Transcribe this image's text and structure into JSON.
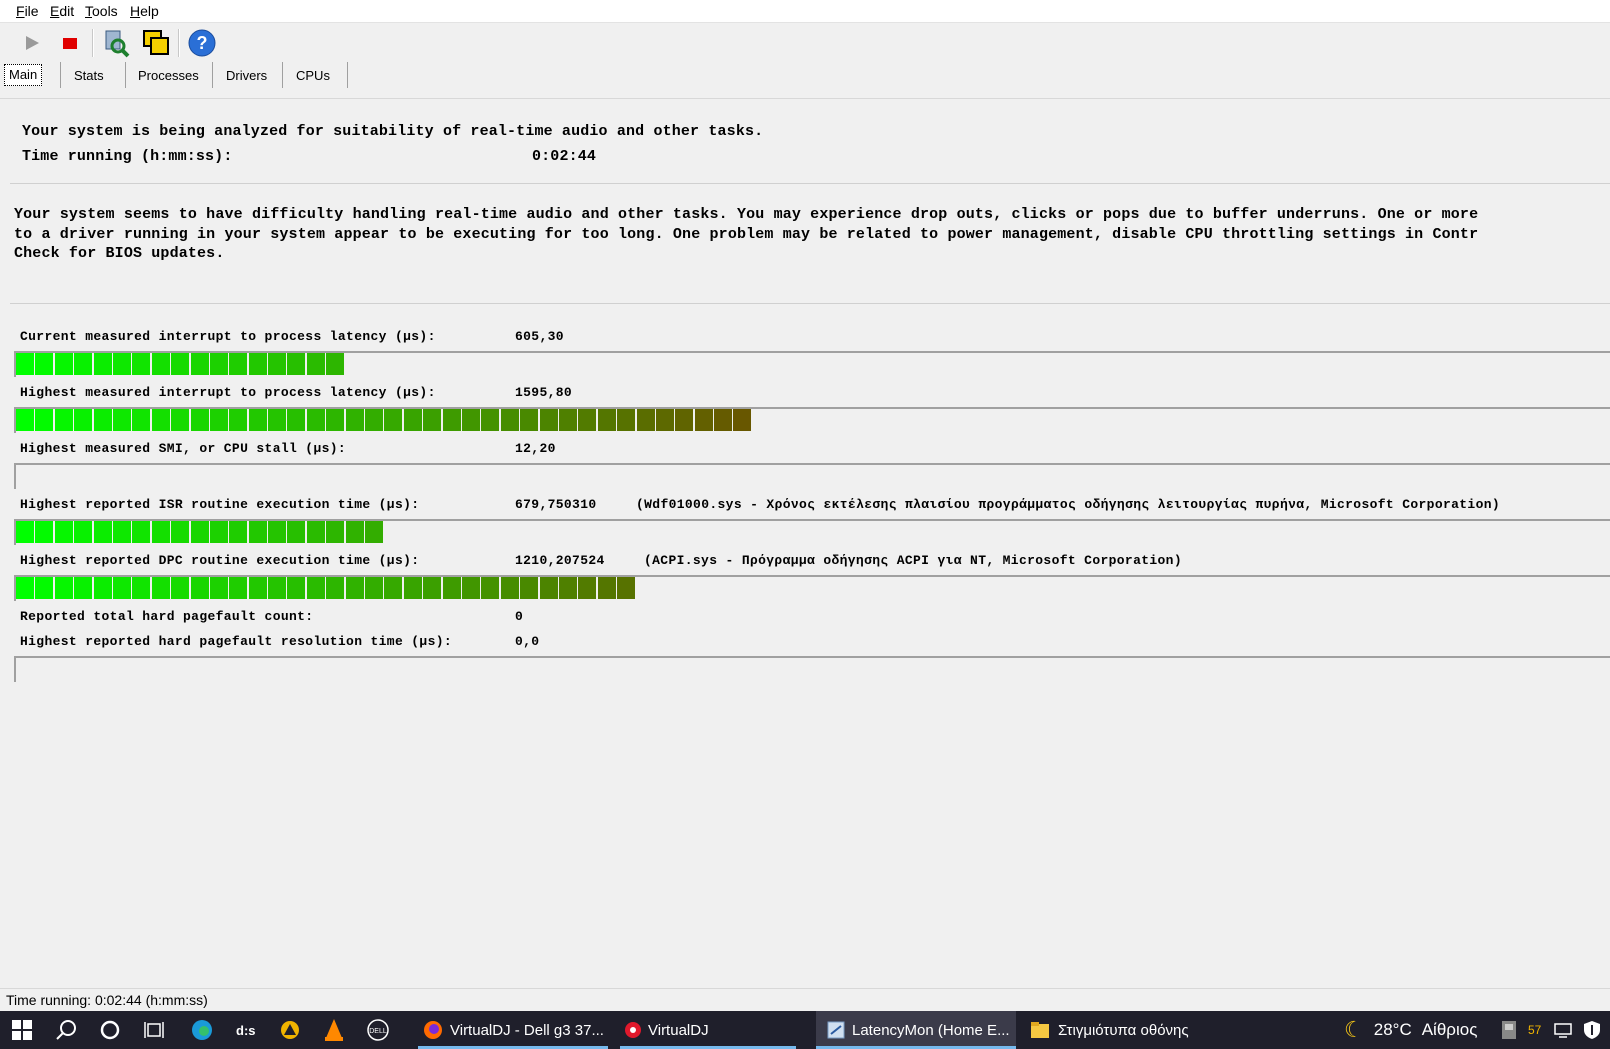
{
  "menu": {
    "items": [
      "File",
      "Edit",
      "Tools",
      "Help"
    ]
  },
  "tabs": [
    "Main",
    "Stats",
    "Processes",
    "Drivers",
    "CPUs"
  ],
  "intro": {
    "line1": "Your system is being analyzed for suitability of real-time audio and other tasks.",
    "time_label": "Time running (h:mm:ss):",
    "time_value": "0:02:44"
  },
  "warning": {
    "text": "Your system seems to have difficulty handling real-time audio and other tasks. You may experience drop outs, clicks or pops due to buffer underruns. One or more\nto a driver running in your system appear to be executing for too long. One problem may be related to power management, disable CPU throttling settings in Contr\nCheck for BIOS updates."
  },
  "metrics": {
    "current_latency": {
      "label": "Current measured interrupt to process latency (µs):",
      "value": "605,30",
      "level": 0.205
    },
    "highest_latency": {
      "label": "Highest measured interrupt to process latency (µs):",
      "value": "1595,80",
      "level": 0.468
    },
    "smi": {
      "label": "Highest measured SMI, or CPU stall (µs):",
      "value": "12,20",
      "level": 0
    },
    "isr": {
      "label": "Highest reported ISR routine execution time (µs):",
      "value": "679,750310",
      "detail": "(Wdf01000.sys - Χρόνος εκτέλεσης πλαισίου προγράμματος οδήγησης λειτουργίας πυρήνα, Microsoft Corporation)",
      "level": 0.23
    },
    "dpc": {
      "label": "Highest reported DPC routine execution time (µs):",
      "value": "1210,207524",
      "detail": "(ACPI.sys - Πρόγραμμα οδήγησης ACPI για NT, Microsoft Corporation)",
      "level": 0.395
    },
    "pagefault_count": {
      "label": "Reported total hard pagefault count:",
      "value": "0"
    },
    "pagefault_time": {
      "label": "Highest reported hard pagefault resolution time (µs):",
      "value": "0,0",
      "level": 0
    }
  },
  "status": {
    "text": "Time running: 0:02:44  (h:mm:ss)"
  },
  "taskbar": {
    "apps": [
      "VirtualDJ - Dell g3 37...",
      "VirtualDJ",
      "LatencyMon  (Home E...",
      "Στιγμιότυπα οθόνης"
    ],
    "temperature": "28°C",
    "weather": "Αίθριος",
    "badge": "57"
  },
  "colors": {
    "bar_start": "#00ff00",
    "bar_end": "#6b5200",
    "taskbar": "#1f1f2b"
  }
}
